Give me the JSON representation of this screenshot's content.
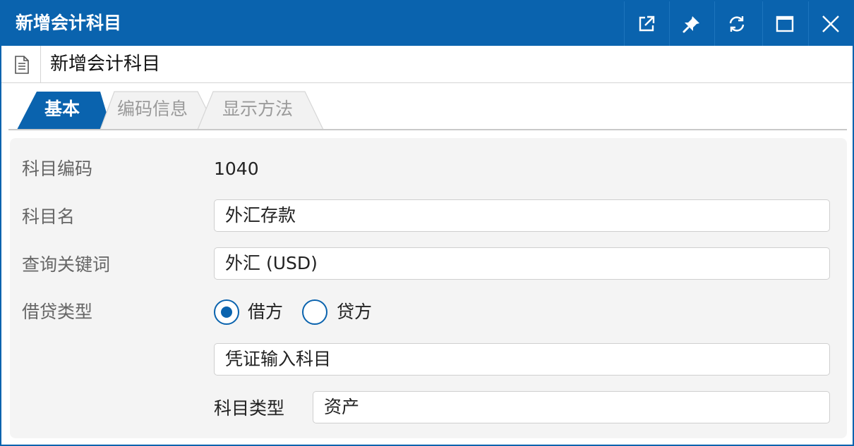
{
  "window": {
    "title": "新增会计科目",
    "controls": [
      "external-link-icon",
      "pin-icon",
      "refresh-icon",
      "maximize-icon",
      "close-icon"
    ]
  },
  "header": {
    "subtitle": "新增会计科目",
    "icon": "document-icon"
  },
  "tabs": [
    {
      "label": "基本",
      "active": true
    },
    {
      "label": "编码信息",
      "active": false
    },
    {
      "label": "显示方法",
      "active": false
    }
  ],
  "form": {
    "code": {
      "label": "科目编码",
      "value": "1040"
    },
    "name": {
      "label": "科目名",
      "value": "外汇存款"
    },
    "keyword": {
      "label": "查询关键词",
      "value": "外汇 (USD)"
    },
    "balance_type": {
      "label": "借贷类型",
      "options": [
        {
          "label": "借方",
          "checked": true
        },
        {
          "label": "贷方",
          "checked": false
        }
      ]
    },
    "voucher_entry": {
      "value": "凭证输入科目"
    },
    "account_type": {
      "label": "科目类型",
      "value": "资产"
    }
  },
  "colors": {
    "primary": "#0a63ae",
    "panel": "#f4f4f4",
    "label": "#666666"
  }
}
